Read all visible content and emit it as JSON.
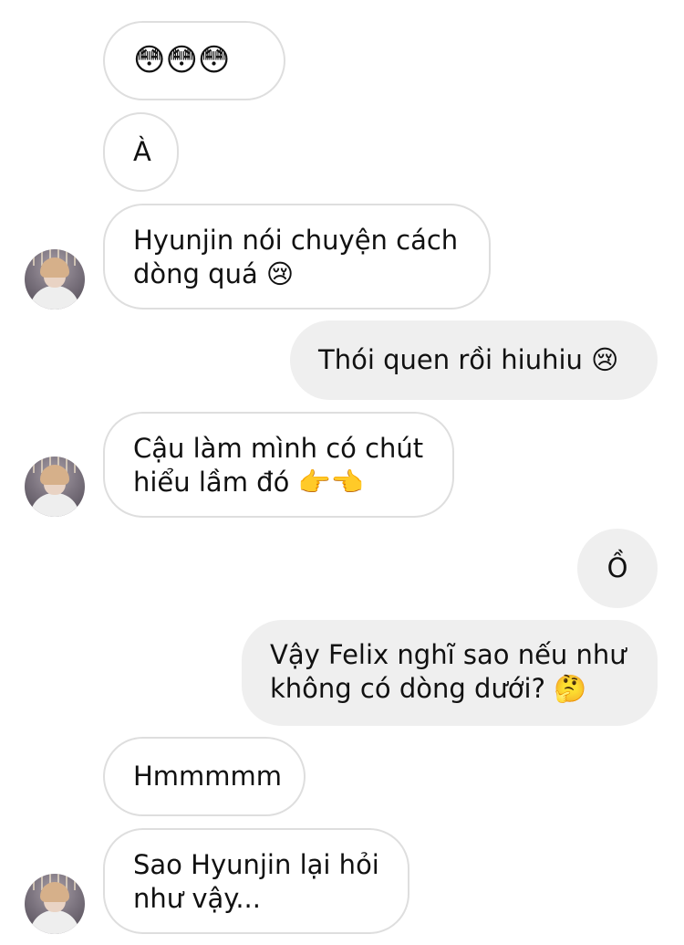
{
  "conversation": {
    "messages": [
      {
        "sender": "them",
        "lines": [
          "😳😳😳"
        ]
      },
      {
        "sender": "them",
        "lines": [
          "À"
        ]
      },
      {
        "sender": "them",
        "lines": [
          "Hyunjin nói chuyện cách",
          "dòng quá 😢"
        ],
        "avatar": true
      },
      {
        "sender": "me",
        "lines": [
          "Thói quen rồi hiuhiu 😢"
        ]
      },
      {
        "sender": "them",
        "lines": [
          "Cậu làm mình có chút",
          "hiểu lầm đó 👉👈"
        ],
        "avatar": true
      },
      {
        "sender": "me",
        "lines": [
          "Ồ"
        ]
      },
      {
        "sender": "me",
        "lines": [
          "Vậy Felix nghĩ sao nếu như",
          "không có dòng dưới? 🤔"
        ]
      },
      {
        "sender": "them",
        "lines": [
          "Hmmmmm"
        ]
      },
      {
        "sender": "them",
        "lines": [
          "Sao Hyunjin lại hỏi",
          "như vậy..."
        ],
        "avatar": true
      }
    ]
  },
  "colors": {
    "outgoing_bubble": "#efefef",
    "incoming_border": "#dedede",
    "text": "#111111"
  }
}
